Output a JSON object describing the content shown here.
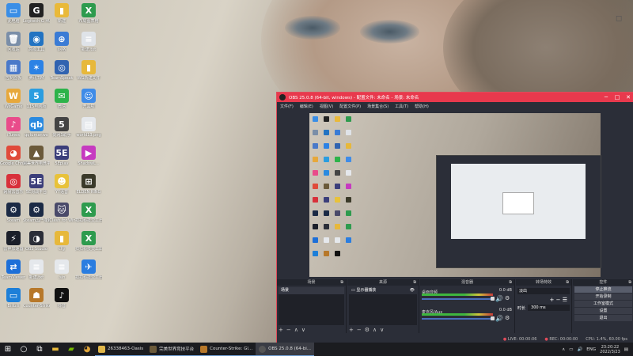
{
  "desktop": {
    "icons": [
      {
        "label": "此电脑",
        "color": "#3a8ee6",
        "glyph": "▭"
      },
      {
        "label": "Logitech G HUB",
        "color": "#222",
        "glyph": "G"
      },
      {
        "label": "新建",
        "color": "#e9b93a",
        "glyph": "▮"
      },
      {
        "label": "布局图表格",
        "color": "#2e9b4e",
        "glyph": "X"
      },
      {
        "label": "回收站",
        "color": "#7a8ea8",
        "glyph": "🗑"
      },
      {
        "label": "高级工具",
        "color": "#2273c2",
        "glyph": "◉"
      },
      {
        "label": "网络",
        "color": "#3a7bd5",
        "glyph": "⊕"
      },
      {
        "label": "新建.txt",
        "color": "#dfe3e8",
        "glyph": "≡"
      },
      {
        "label": "控制面板",
        "color": "#4a79c9",
        "glyph": "▦"
      },
      {
        "label": "腾讯TIM",
        "color": "#2c82e5",
        "glyph": "✶"
      },
      {
        "label": "TeamSpeak",
        "color": "#3163b0",
        "glyph": "◎"
      },
      {
        "label": "WG新建文件",
        "color": "#e7b83b",
        "glyph": "▮"
      },
      {
        "label": "WeGame",
        "color": "#e7a83b",
        "glyph": "W"
      },
      {
        "label": "115电脑版",
        "color": "#2a9de0",
        "glyph": "5"
      },
      {
        "label": "微信",
        "color": "#2db34a",
        "glyph": "✉"
      },
      {
        "label": "开黑啦",
        "color": "#3f8ce8",
        "glyph": "☺"
      },
      {
        "label": "iTunes",
        "color": "#e94b8a",
        "glyph": "♪"
      },
      {
        "label": "qqtumanwo",
        "color": "#2a8ae0",
        "glyph": "qb"
      },
      {
        "label": "剑网3助手",
        "color": "#444",
        "glyph": "5"
      },
      {
        "label": "world13.png",
        "color": "#e5e8ec",
        "glyph": "▤"
      },
      {
        "label": "Google Chrome",
        "color": "#e04a3a",
        "glyph": "◕"
      },
      {
        "label": "完美世界电竞平台",
        "color": "#6b5a3a",
        "glyph": "▲"
      },
      {
        "label": "5Eplay",
        "color": "#3b3e7a",
        "glyph": "5E"
      },
      {
        "label": "ShadowL...",
        "color": "#c63ac0",
        "glyph": "▶"
      },
      {
        "label": "网易云音乐",
        "color": "#d8303a",
        "glyph": "◎"
      },
      {
        "label": "5E对战平台",
        "color": "#3b3e7a",
        "glyph": "5E"
      },
      {
        "label": "YY语音",
        "color": "#e8c23a",
        "glyph": "☻"
      },
      {
        "label": "ELDEN RING",
        "color": "#3b3a2a",
        "glyph": "⊞"
      },
      {
        "label": "Steam",
        "color": "#1b2a45",
        "glyph": "⚙"
      },
      {
        "label": "Steam国产降速启动器",
        "color": "#1b2a45",
        "glyph": "⚙"
      },
      {
        "label": "iClash for Windows",
        "color": "#4a4a6a",
        "glyph": "🐱"
      },
      {
        "label": "扣扣科技交工出报表",
        "color": "#2e9b4e",
        "glyph": "X"
      },
      {
        "label": "雷神加速器",
        "color": "#1b1f2a",
        "glyph": "⚡"
      },
      {
        "label": "OBS Studio",
        "color": "#2b2e38",
        "glyph": "◑"
      },
      {
        "label": "cfg",
        "color": "#e7b83b",
        "glyph": "▮"
      },
      {
        "label": "扣扣科技交工出报表.xlsx",
        "color": "#2e9b4e",
        "glyph": "X"
      },
      {
        "label": "TeamViewer",
        "color": "#1d6fd8",
        "glyph": "⇄"
      },
      {
        "label": "新建.txt",
        "color": "#e5e8ec",
        "glyph": "≡"
      },
      {
        "label": ".sin",
        "color": "#e5e8ec",
        "glyph": "≡"
      },
      {
        "label": "扣扣科技交工出报表",
        "color": "#2a7de0",
        "glyph": "✈"
      },
      {
        "label": "Bilibili",
        "color": "#1d7fd8",
        "glyph": "▭"
      },
      {
        "label": "Counter-Strike: Global Off...",
        "color": "#b7782a",
        "glyph": "☗"
      },
      {
        "label": "抖音",
        "color": "#111",
        "glyph": "♪"
      }
    ]
  },
  "obs": {
    "title": "OBS 25.0.8 (64-bit, windows) - 配置文件: 未命名 - 场景: 未命名",
    "menu": [
      "文件(F)",
      "编辑(E)",
      "视图(V)",
      "配置文件(P)",
      "场景集合(S)",
      "工具(T)",
      "帮助(H)"
    ],
    "docks": {
      "scenes": {
        "title": "场景",
        "items": [
          "场景"
        ]
      },
      "sources": {
        "title": "来源",
        "items": [
          "显示器捕获"
        ]
      },
      "mixer": {
        "title": "混音器",
        "tracks": [
          {
            "name": "桌面音频",
            "db": "0.0 dB",
            "level": 0.7
          },
          {
            "name": "麦克风/Aux",
            "db": "0.0 dB",
            "level": 0.7
          }
        ]
      },
      "transitions": {
        "title": "转场特效",
        "type": "淡出",
        "duration_label": "时长",
        "duration": "300 ms"
      },
      "controls": {
        "title": "控件",
        "buttons": [
          "停止推流",
          "开始录制",
          "工作室模式",
          "设置",
          "退出"
        ]
      }
    },
    "status": {
      "live": "LIVE: 00:00:06",
      "rec": "REC: 00:00:00",
      "cpu": "CPU: 1.4%, 60.00 fps"
    }
  },
  "taskbar": {
    "apps": [
      {
        "label": "26338463-Oasis",
        "color": "#e0b74a"
      },
      {
        "label": "完美世界竞技平台",
        "color": "#6b5a3a"
      },
      {
        "label": "Counter-Strike: Gl...",
        "color": "#b7782a"
      },
      {
        "label": "OBS 25.0.8 (64-bi...",
        "color": "#2b2e38"
      }
    ],
    "tray": {
      "lang": "ENG",
      "time": "23:20:22",
      "date": "2022/3/23"
    }
  }
}
